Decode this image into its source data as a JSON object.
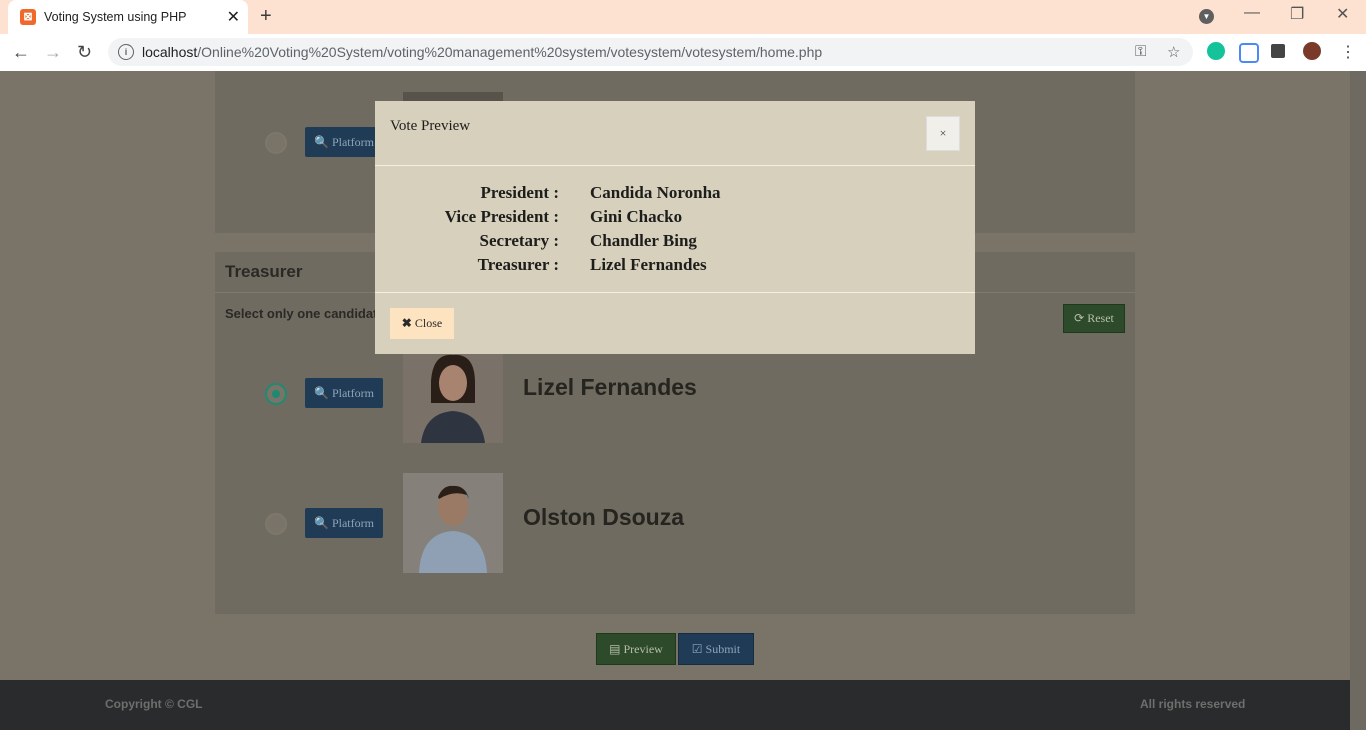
{
  "browser": {
    "tab_title": "Voting System using PHP",
    "url_host": "localhost",
    "url_path": "/Online%20Voting%20System/voting%20management%20system/votesystem/votesystem/home.php"
  },
  "treasurer_panel": {
    "title": "Treasurer",
    "instruction": "Select only one candidat",
    "reset_label": "Reset",
    "candidates": [
      {
        "name": "Lizel Fernandes",
        "platform_label": "Platform",
        "selected": true
      },
      {
        "name": "Olston Dsouza",
        "platform_label": "Platform",
        "selected": false
      }
    ]
  },
  "upper_panel": {
    "platform_label": "Platform"
  },
  "actions": {
    "preview_label": "Preview",
    "submit_label": "Submit"
  },
  "footer": {
    "copyright": "Copyright © CGL",
    "rights": "All rights reserved"
  },
  "modal": {
    "title": "Vote Preview",
    "close_x": "×",
    "rows": [
      {
        "position": "President :",
        "candidate": "Candida Noronha"
      },
      {
        "position": "Vice President :",
        "candidate": "Gini Chacko"
      },
      {
        "position": "Secretary :",
        "candidate": "Chandler Bing"
      },
      {
        "position": "Treasurer :",
        "candidate": "Lizel Fernandes"
      }
    ],
    "close_label": "Close"
  }
}
